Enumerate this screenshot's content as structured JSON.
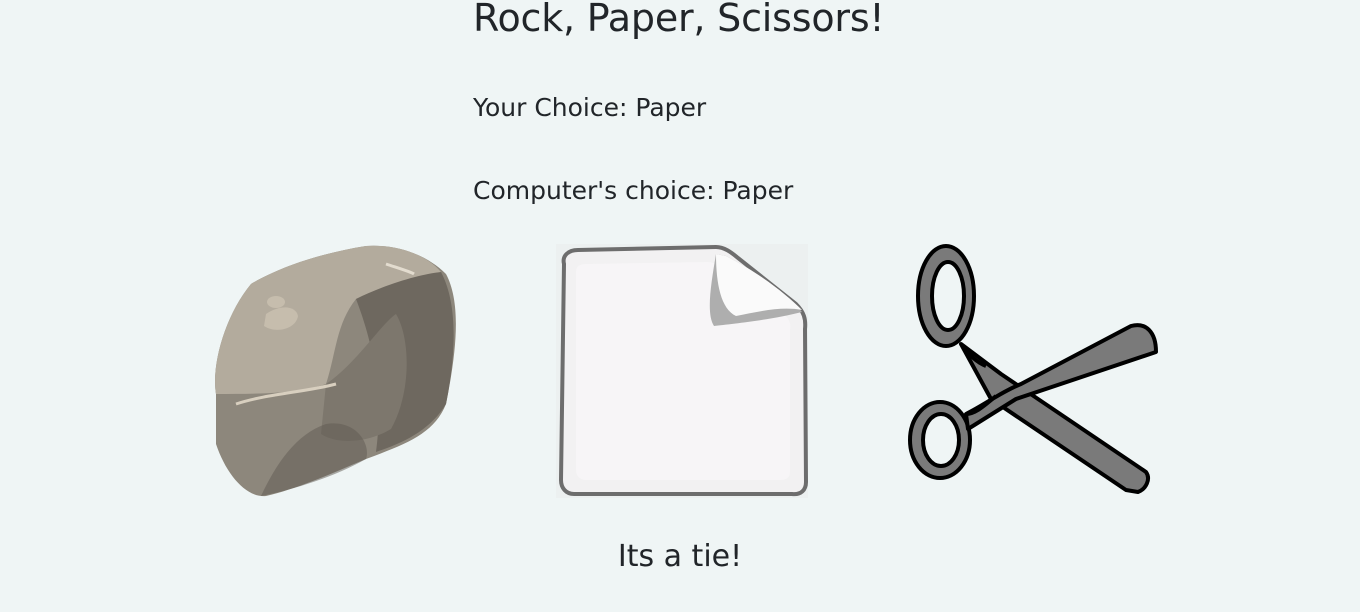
{
  "game": {
    "title": "Rock, Paper, Scissors!",
    "your_choice_label": "Your Choice:",
    "your_choice_value": "Paper",
    "computer_choice_label": "Computer's choice:",
    "computer_choice_value": "Paper",
    "result": "Its a tie!"
  },
  "options": [
    {
      "name": "rock",
      "icon": "rock-icon"
    },
    {
      "name": "paper",
      "icon": "paper-icon"
    },
    {
      "name": "scissors",
      "icon": "scissors-icon"
    }
  ],
  "colors": {
    "background": "#eff5f5",
    "text": "#212529",
    "scissors_blade": "#7a7a7a"
  }
}
